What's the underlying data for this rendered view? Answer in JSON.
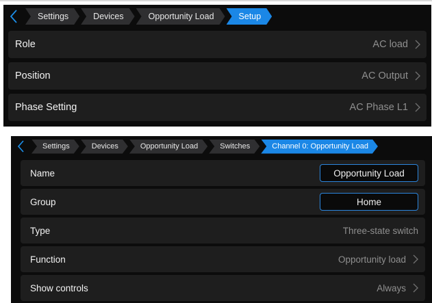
{
  "colors": {
    "accent": "#1b87e6",
    "panel_bg": "#0c0c0c",
    "row_bg": "#1e1e1e",
    "crumb_bg": "#2f2f31",
    "value_text": "#8f8f8f",
    "field_border": "#2b86de"
  },
  "panel1": {
    "back_icon": "chevron-left-icon",
    "breadcrumbs": [
      "Settings",
      "Devices",
      "Opportunity Load",
      "Setup"
    ],
    "rows": [
      {
        "label": "Role",
        "value": "AC load",
        "icon": "chevron-right-icon"
      },
      {
        "label": "Position",
        "value": "AC Output",
        "icon": "chevron-right-icon"
      },
      {
        "label": "Phase Setting",
        "value": "AC Phase L1",
        "icon": "chevron-right-icon"
      }
    ]
  },
  "panel2": {
    "back_icon": "chevron-left-icon",
    "breadcrumbs": [
      "Settings",
      "Devices",
      "Opportunity Load",
      "Switches",
      "Channel 0: Opportunity Load"
    ],
    "rows": [
      {
        "label": "Name",
        "value": "Opportunity Load"
      },
      {
        "label": "Group",
        "value": "Home"
      },
      {
        "label": "Type",
        "value": "Three-state switch"
      },
      {
        "label": "Function",
        "value": "Opportunity load",
        "icon": "chevron-right-icon"
      },
      {
        "label": "Show controls",
        "value": "Always",
        "icon": "chevron-right-icon"
      }
    ]
  }
}
